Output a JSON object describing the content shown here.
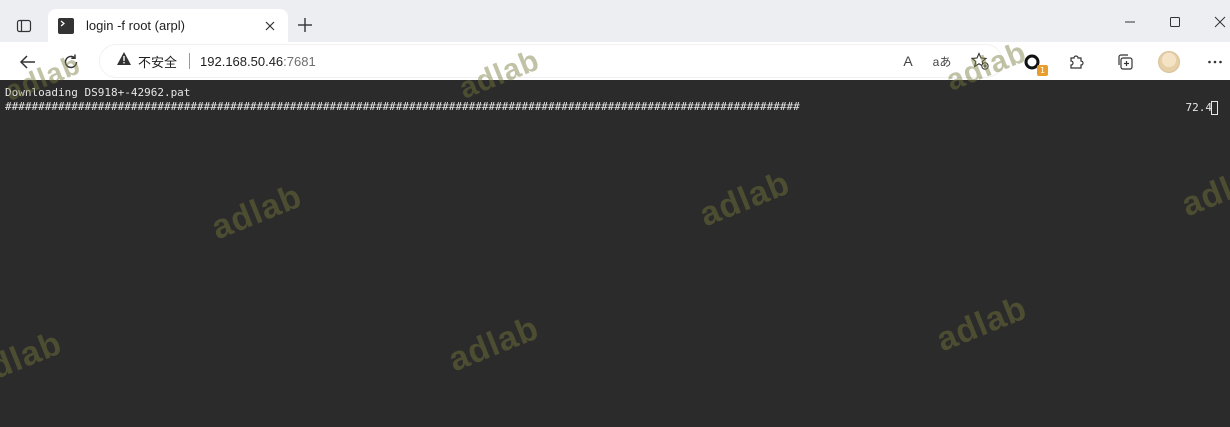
{
  "tab": {
    "title": "login -f root (arpl)"
  },
  "address_bar": {
    "security_label": "不安全",
    "url_host": "192.168.50.46",
    "url_port": ":7681"
  },
  "toolbar": {
    "read_aloud_glyph": "A",
    "translate_glyph": "aあ",
    "extension_badge": "1"
  },
  "terminal": {
    "line1": "Downloading DS918+-42962.pat",
    "progress_bar": "########################################################################################################################",
    "percent": "72.4"
  },
  "watermark": {
    "text": "adlab"
  },
  "icons": [
    "tab-actions-icon",
    "terminal-favicon-icon",
    "close-icon",
    "plus-icon",
    "minimize-icon",
    "maximize-icon",
    "window-close-icon",
    "back-arrow-icon",
    "reload-icon",
    "warning-icon",
    "read-aloud-icon",
    "translate-icon",
    "favorite-add-icon",
    "extension-icon",
    "puzzle-icon",
    "collections-icon",
    "avatar",
    "more-icon"
  ],
  "colors": {
    "terminal_bg": "#2b2b2b",
    "terminal_fg": "#e6e6e6",
    "chrome_bg": "#eceef2",
    "watermark": "#78783c"
  }
}
